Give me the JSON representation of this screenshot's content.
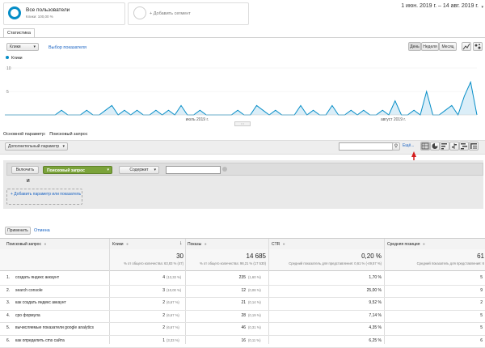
{
  "segments": {
    "all_users": {
      "title": "Все пользователи",
      "subtitle": "Клики: 100,00 %"
    },
    "add_segment": "+ Добавить сегмент"
  },
  "date_range": "1 июн. 2019 г. – 14 авг. 2019 г.",
  "tabs": {
    "statistics": "Статистика"
  },
  "metric_select": "Клики",
  "metric_select_link": "Выбор показателя",
  "period_buttons": [
    "День",
    "Неделя",
    "Месяц"
  ],
  "chart_data": {
    "type": "area",
    "series": [
      {
        "name": "Клики",
        "values": [
          0,
          0,
          0,
          0,
          0,
          0,
          0,
          0,
          0,
          1,
          0,
          0,
          0,
          1,
          0,
          0,
          1,
          2,
          0,
          1,
          0,
          1,
          0,
          0,
          1,
          0,
          1,
          0,
          2,
          0,
          0,
          1,
          0,
          0,
          0,
          0,
          0,
          1,
          0,
          0,
          2,
          1,
          0,
          1,
          0,
          0,
          0,
          2,
          0,
          1,
          0,
          0,
          2,
          0,
          0,
          1,
          0,
          1,
          0,
          0,
          1,
          0,
          3,
          0,
          0,
          1,
          0,
          5,
          0,
          0,
          1,
          2,
          0,
          4,
          7,
          0
        ]
      }
    ],
    "legend": "Клики",
    "y_ticks": [
      "10",
      "5"
    ],
    "x_labels": [
      "июль 2019 г.",
      "август 2019 г."
    ],
    "ylim": [
      0,
      10
    ],
    "color": "#058dc7"
  },
  "primary_dimension": {
    "label": "Основной параметр:",
    "value": "Поисковый запрос"
  },
  "secondary_dimension": "Дополнительный параметр",
  "search_input": "",
  "advanced_link": "Ещё...",
  "filter": {
    "include": "Включить",
    "dimension": "Поисковый запрос",
    "operator": "Содержит",
    "value": "",
    "and_label": "И",
    "add_param": "+ Добавить параметр или показатель"
  },
  "apply_button": "Применить",
  "cancel_link": "Отмена",
  "table": {
    "headers": [
      "Поисковый запрос",
      "Клики",
      "Показы",
      "CTR",
      "Средняя позиция"
    ],
    "totals": {
      "clicks": "30",
      "clicks_sub": "% от общего количества: 63,83 % (47)",
      "impressions": "14 685",
      "impressions_sub": "% от общего количества: 98,21 % (17 530)",
      "ctr": "0,20 %",
      "ctr_sub": "Средний показатель для представления: 0,61 % (-49,57 %)",
      "position": "61",
      "position_sub": "Средний показатель для представления: 6"
    },
    "rows": [
      {
        "n": "1.",
        "query": "создать яндекс аккаунт",
        "clicks": "4",
        "clicks_pct": "(13,33 %)",
        "impr": "235",
        "impr_pct": "(1,60 %)",
        "ctr": "1,70 %",
        "pos": "5"
      },
      {
        "n": "2.",
        "query": "search console",
        "clicks": "3",
        "clicks_pct": "(10,00 %)",
        "impr": "12",
        "impr_pct": "(0,08 %)",
        "ctr": "25,00 %",
        "pos": "9"
      },
      {
        "n": "3.",
        "query": "как создать яндекс аккаунт",
        "clicks": "2",
        "clicks_pct": "(6,67 %)",
        "impr": "21",
        "impr_pct": "(0,14 %)",
        "ctr": "9,52 %",
        "pos": "2"
      },
      {
        "n": "4.",
        "query": "cpo формула",
        "clicks": "2",
        "clicks_pct": "(6,67 %)",
        "impr": "28",
        "impr_pct": "(0,19 %)",
        "ctr": "7,14 %",
        "pos": "5"
      },
      {
        "n": "5.",
        "query": "вычисляемые показатели google analytics",
        "clicks": "2",
        "clicks_pct": "(6,67 %)",
        "impr": "46",
        "impr_pct": "(0,31 %)",
        "ctr": "4,35 %",
        "pos": "5"
      },
      {
        "n": "6.",
        "query": "как определить cms сайта",
        "clicks": "1",
        "clicks_pct": "(3,33 %)",
        "impr": "16",
        "impr_pct": "(0,11 %)",
        "ctr": "6,25 %",
        "pos": "6"
      }
    ]
  }
}
